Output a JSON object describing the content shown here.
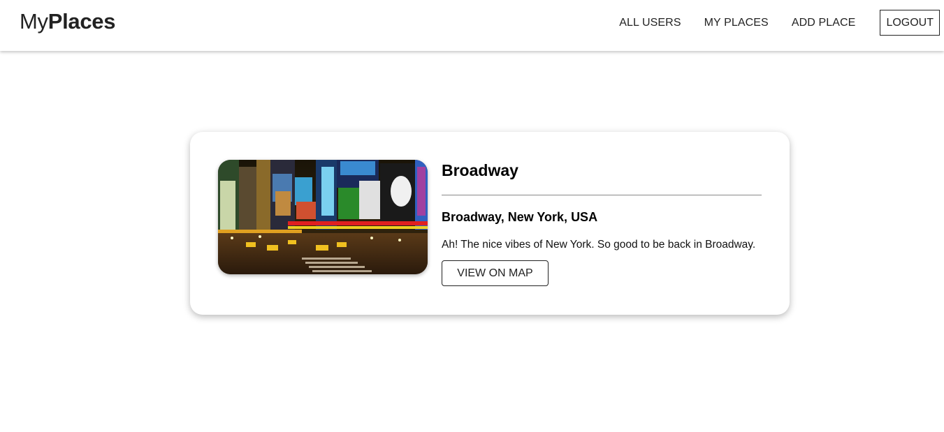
{
  "header": {
    "logo_light": "My",
    "logo_bold": "Places",
    "nav": {
      "all_users": "ALL USERS",
      "my_places": "MY PLACES",
      "add_place": "ADD PLACE",
      "logout": "LOGOUT"
    }
  },
  "place": {
    "image_icon": "times-square-photo",
    "title": "Broadway",
    "address": "Broadway, New York, USA",
    "description": "Ah! The nice vibes of New York. So good to be back in Broadway.",
    "view_on_map": "VIEW ON MAP"
  }
}
